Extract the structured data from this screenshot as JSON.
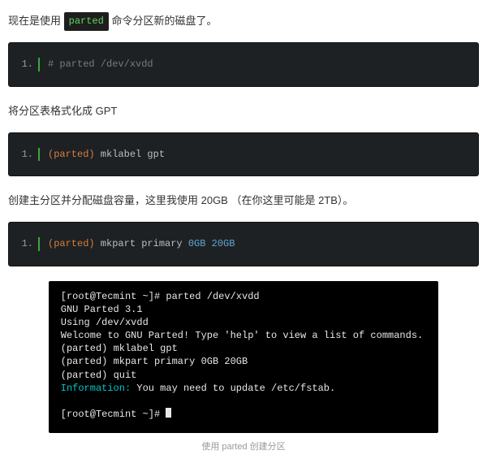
{
  "p1": {
    "before": "现在是使用 ",
    "code": "parted",
    "after": " 命令分区新的磁盘了。"
  },
  "code1": {
    "lineno": "1.",
    "comment": "# parted /dev/xvdd"
  },
  "p2": "将分区表格式化成 GPT",
  "code2": {
    "lineno": "1.",
    "tag": "(parted)",
    "cmd": " mklabel gpt"
  },
  "p3": "创建主分区并分配磁盘容量，这里我使用 20GB （在你这里可能是 2TB）。",
  "code3": {
    "lineno": "1.",
    "tag": "(parted)",
    "cmd": " mkpart primary ",
    "size": "0GB 20GB"
  },
  "terminal": {
    "l1a": "[root@Tecmint ~]# ",
    "l1b": "parted /dev/xvdd",
    "l2": "GNU Parted 3.1",
    "l3": "Using /dev/xvdd",
    "l4": "Welcome to GNU Parted! Type 'help' to view a list of commands.",
    "l5a": "(parted) ",
    "l5b": "mklabel gpt",
    "l6a": "(parted) ",
    "l6b": "mkpart primary 0GB 20GB",
    "l7a": "(parted) ",
    "l7b": "quit",
    "l8a": "Information:",
    "l8b": " You may need to update /etc/fstab.",
    "l9": "[root@Tecmint ~]# "
  },
  "caption": "使用 parted 创建分区"
}
